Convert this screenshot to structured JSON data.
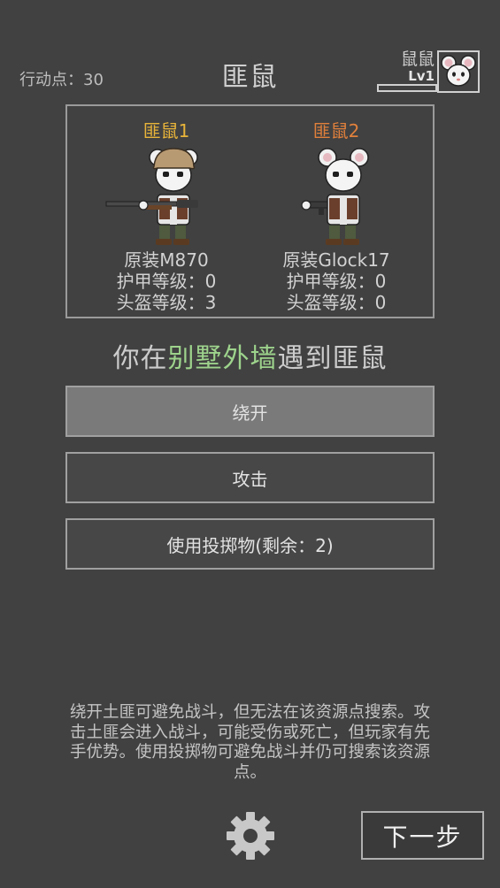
{
  "header": {
    "action_points_label": "行动点：30",
    "title": "匪鼠",
    "player_name": "鼠鼠",
    "player_level": "Lv1"
  },
  "enemies": [
    {
      "name": "匪鼠1",
      "name_color": "#e8b43a",
      "weapon": "原装M870",
      "armor": "护甲等级：0",
      "helmet": "头盔等级：3"
    },
    {
      "name": "匪鼠2",
      "name_color": "#e0803c",
      "weapon": "原装Glock17",
      "armor": "护甲等级：0",
      "helmet": "头盔等级：0"
    }
  ],
  "encounter": {
    "prefix": "你在",
    "location": "别墅外墙",
    "suffix": "遇到匪鼠",
    "location_color": "#9dd38c"
  },
  "actions": {
    "bypass": "绕开",
    "attack": "攻击",
    "throw": "使用投掷物(剩余：2)"
  },
  "hint": "绕开土匪可避免战斗，但无法在该资源点搜索。攻击土匪会进入战斗，可能受伤或死亡，但玩家有先手优势。使用投掷物可避免战斗并仍可搜索该资源点。",
  "footer": {
    "next_label": "下一步",
    "settings_icon": "gear-icon"
  },
  "colors": {
    "background": "#414141",
    "selected_button": "#7a7a7a"
  }
}
